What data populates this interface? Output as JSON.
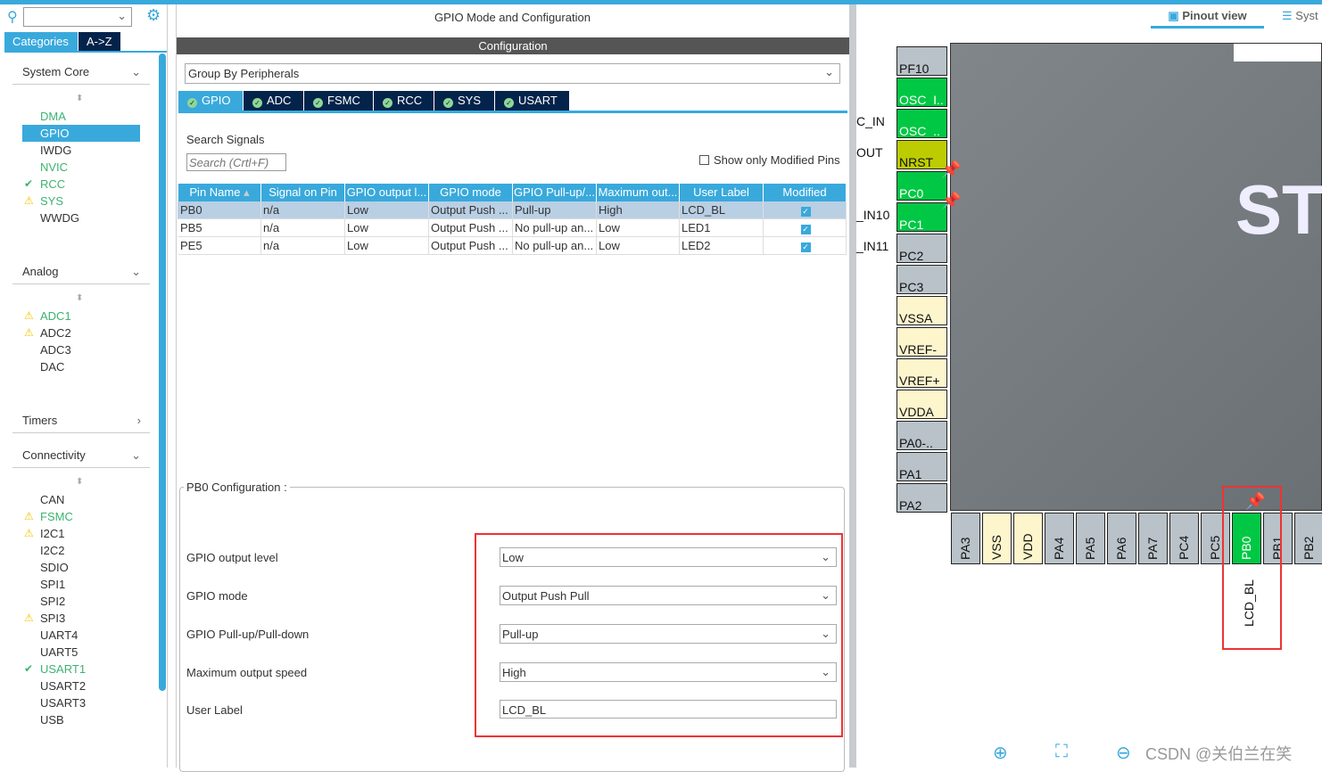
{
  "left_panel": {
    "search_value": "",
    "tabs": [
      "Categories",
      "A->Z"
    ],
    "sections": [
      {
        "title": "System Core",
        "items": [
          {
            "label": "DMA",
            "status": "",
            "color": "green"
          },
          {
            "label": "GPIO",
            "status": "selected",
            "color": "white"
          },
          {
            "label": "IWDG",
            "status": "",
            "color": "dark"
          },
          {
            "label": "NVIC",
            "status": "",
            "color": "green"
          },
          {
            "label": "RCC",
            "status": "check",
            "color": "green"
          },
          {
            "label": "SYS",
            "status": "warning",
            "color": "green"
          },
          {
            "label": "WWDG",
            "status": "",
            "color": "dark"
          }
        ]
      },
      {
        "title": "Analog",
        "items": [
          {
            "label": "ADC1",
            "status": "warning",
            "color": "green"
          },
          {
            "label": "ADC2",
            "status": "warning",
            "color": "dark"
          },
          {
            "label": "ADC3",
            "status": "",
            "color": "dark"
          },
          {
            "label": "DAC",
            "status": "",
            "color": "dark"
          }
        ]
      },
      {
        "title": "Timers",
        "items": []
      },
      {
        "title": "Connectivity",
        "items": [
          {
            "label": "CAN",
            "status": "",
            "color": "dark"
          },
          {
            "label": "FSMC",
            "status": "warning",
            "color": "green"
          },
          {
            "label": "I2C1",
            "status": "warning",
            "color": "dark"
          },
          {
            "label": "I2C2",
            "status": "",
            "color": "dark"
          },
          {
            "label": "SDIO",
            "status": "",
            "color": "dark"
          },
          {
            "label": "SPI1",
            "status": "",
            "color": "dark"
          },
          {
            "label": "SPI2",
            "status": "",
            "color": "dark"
          },
          {
            "label": "SPI3",
            "status": "warning",
            "color": "dark"
          },
          {
            "label": "UART4",
            "status": "",
            "color": "dark"
          },
          {
            "label": "UART5",
            "status": "",
            "color": "dark"
          },
          {
            "label": "USART1",
            "status": "check",
            "color": "green"
          },
          {
            "label": "USART2",
            "status": "",
            "color": "dark"
          },
          {
            "label": "USART3",
            "status": "",
            "color": "dark"
          },
          {
            "label": "USB",
            "status": "",
            "color": "dark"
          }
        ]
      }
    ]
  },
  "mid": {
    "title": "GPIO Mode and Configuration",
    "config_bar": "Configuration",
    "group_by": "Group By Peripherals",
    "tabs": [
      "GPIO",
      "ADC",
      "FSMC",
      "RCC",
      "SYS",
      "USART"
    ],
    "search_label": "Search Signals",
    "search_placeholder": "Search (Crtl+F)",
    "show_modified": "Show only Modified Pins",
    "table": {
      "headers": [
        "Pin Name",
        "Signal on Pin",
        "GPIO output l...",
        "GPIO mode",
        "GPIO Pull-up/...",
        "Maximum out...",
        "User Label",
        "Modified"
      ],
      "rows": [
        [
          "PB0",
          "n/a",
          "Low",
          "Output Push ...",
          "Pull-up",
          "High",
          "LCD_BL",
          true
        ],
        [
          "PB5",
          "n/a",
          "Low",
          "Output Push ...",
          "No pull-up an...",
          "Low",
          "LED1",
          true
        ],
        [
          "PE5",
          "n/a",
          "Low",
          "Output Push ...",
          "No pull-up an...",
          "Low",
          "LED2",
          true
        ]
      ]
    },
    "pb0_config": {
      "title": "PB0 Configuration :",
      "fields": [
        {
          "label": "GPIO output level",
          "value": "Low"
        },
        {
          "label": "GPIO mode",
          "value": "Output Push Pull"
        },
        {
          "label": "GPIO Pull-up/Pull-down",
          "value": "Pull-up"
        },
        {
          "label": "Maximum output speed",
          "value": "High"
        },
        {
          "label": "User Label",
          "value": "LCD_BL"
        }
      ]
    }
  },
  "right": {
    "tabs": [
      "Pinout view",
      "Syst"
    ],
    "chip_logo": "ST",
    "left_pins": [
      {
        "name": "PF10",
        "c": "gray",
        "sig": ""
      },
      {
        "name": "OSC_I..",
        "c": "grn",
        "sig": "C_IN"
      },
      {
        "name": "OSC_..",
        "c": "grn",
        "sig": "OUT"
      },
      {
        "name": "NRST",
        "c": "yel",
        "sig": ""
      },
      {
        "name": "PC0",
        "c": "grn",
        "sig": "_IN10"
      },
      {
        "name": "PC1",
        "c": "grn",
        "sig": "_IN11"
      },
      {
        "name": "PC2",
        "c": "gray",
        "sig": ""
      },
      {
        "name": "PC3",
        "c": "gray",
        "sig": ""
      },
      {
        "name": "VSSA",
        "c": "cream",
        "sig": ""
      },
      {
        "name": "VREF-",
        "c": "cream",
        "sig": ""
      },
      {
        "name": "VREF+",
        "c": "cream",
        "sig": ""
      },
      {
        "name": "VDDA",
        "c": "cream",
        "sig": ""
      },
      {
        "name": "PA0-..",
        "c": "gray",
        "sig": ""
      },
      {
        "name": "PA1",
        "c": "gray",
        "sig": ""
      },
      {
        "name": "PA2",
        "c": "gray",
        "sig": ""
      }
    ],
    "bottom_pins": [
      {
        "name": "PA3",
        "c": "gray"
      },
      {
        "name": "VSS",
        "c": "cream"
      },
      {
        "name": "VDD",
        "c": "cream"
      },
      {
        "name": "PA4",
        "c": "gray"
      },
      {
        "name": "PA5",
        "c": "gray"
      },
      {
        "name": "PA6",
        "c": "gray"
      },
      {
        "name": "PA7",
        "c": "gray"
      },
      {
        "name": "PC4",
        "c": "gray"
      },
      {
        "name": "PC5",
        "c": "gray"
      },
      {
        "name": "PB0",
        "c": "grn"
      },
      {
        "name": "PB1",
        "c": "gray"
      },
      {
        "name": "PB2",
        "c": "gray"
      }
    ],
    "pb0_label": "LCD_BL",
    "watermark": "CSDN @关伯兰在笑"
  },
  "colors": {
    "accent": "#39a9dc",
    "dark_tab": "#03234b",
    "pin_green": "#00c844",
    "highlight": "#e33333"
  }
}
